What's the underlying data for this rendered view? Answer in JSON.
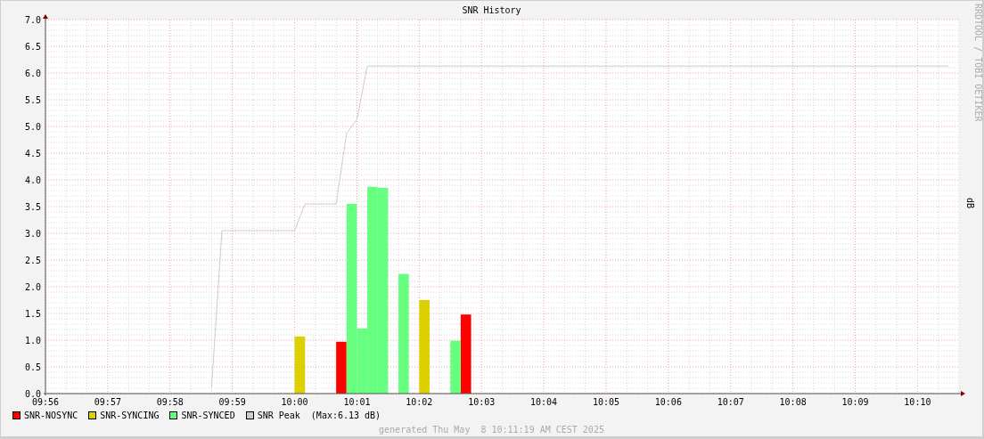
{
  "graph": {
    "title": "SNR History",
    "credit": "RRDTOOL / TOBI OETIKER",
    "legend_note": "(Max:6.13 dB)",
    "footer": "generated Thu May  8 10:11:19 AM CEST 2025",
    "chart_data": {
      "type": "bar",
      "grid": true,
      "ylabel": "dB",
      "ylim": [
        0,
        7
      ],
      "yticks": [
        {
          "value": 0,
          "label": "0.0"
        },
        {
          "value": 0.5,
          "label": "0.5"
        },
        {
          "value": 1,
          "label": "1.0"
        },
        {
          "value": 1.5,
          "label": "1.5"
        },
        {
          "value": 2,
          "label": "2.0"
        },
        {
          "value": 2.5,
          "label": "2.5"
        },
        {
          "value": 3,
          "label": "3.0"
        },
        {
          "value": 3.5,
          "label": "3.5"
        },
        {
          "value": 4,
          "label": "4.0"
        },
        {
          "value": 4.5,
          "label": "4.5"
        },
        {
          "value": 5,
          "label": "5.0"
        },
        {
          "value": 5.5,
          "label": "5.5"
        },
        {
          "value": 6,
          "label": "6.0"
        },
        {
          "value": 6.5,
          "label": "6.5"
        },
        {
          "value": 7,
          "label": "7.0"
        }
      ],
      "categories": [
        "09:56",
        null,
        null,
        null,
        null,
        null,
        "09:57",
        null,
        null,
        null,
        null,
        null,
        "09:58",
        null,
        null,
        null,
        null,
        null,
        "09:59",
        null,
        null,
        null,
        null,
        null,
        "10:00",
        null,
        null,
        null,
        null,
        null,
        "10:01",
        null,
        null,
        null,
        null,
        null,
        "10:02",
        null,
        null,
        null,
        null,
        null,
        "10:03",
        null,
        null,
        null,
        null,
        null,
        "10:04",
        null,
        null,
        null,
        null,
        null,
        "10:05",
        null,
        null,
        null,
        null,
        null,
        "10:06",
        null,
        null,
        null,
        null,
        null,
        "10:07",
        null,
        null,
        null,
        null,
        null,
        "10:08",
        null,
        null,
        null,
        null,
        null,
        "10:09",
        null,
        null,
        null,
        null,
        null,
        "10:10",
        null,
        null,
        null
      ],
      "series": [
        {
          "name": "SNR-NOSYNC",
          "color": "#ff0000",
          "type": "bar",
          "values": [
            null,
            null,
            null,
            null,
            null,
            null,
            null,
            null,
            null,
            null,
            null,
            null,
            null,
            null,
            null,
            null,
            null,
            null,
            null,
            null,
            null,
            null,
            null,
            null,
            null,
            null,
            null,
            null,
            0.97,
            null,
            null,
            null,
            null,
            null,
            null,
            null,
            null,
            null,
            null,
            null,
            1.48,
            null,
            null,
            null,
            null,
            null,
            null,
            null,
            null,
            null,
            null,
            null,
            null,
            null,
            null,
            null,
            null,
            null,
            null,
            null,
            null,
            null,
            null,
            null,
            null,
            null,
            null,
            null,
            null,
            null,
            null,
            null,
            null,
            null,
            null,
            null,
            null,
            null,
            null,
            null,
            null,
            null,
            null,
            null,
            null,
            null,
            null,
            null
          ]
        },
        {
          "name": "SNR-SYNCING",
          "color": "#ddd000",
          "type": "bar",
          "values": [
            null,
            null,
            null,
            null,
            null,
            null,
            null,
            null,
            null,
            null,
            null,
            null,
            null,
            null,
            null,
            null,
            null,
            null,
            null,
            null,
            null,
            null,
            null,
            null,
            1.07,
            null,
            null,
            null,
            null,
            null,
            null,
            null,
            null,
            null,
            null,
            null,
            1.75,
            null,
            null,
            null,
            null,
            null,
            null,
            null,
            null,
            null,
            null,
            null,
            null,
            null,
            null,
            null,
            null,
            null,
            null,
            null,
            null,
            null,
            null,
            null,
            null,
            null,
            null,
            null,
            null,
            null,
            null,
            null,
            null,
            null,
            null,
            null,
            null,
            null,
            null,
            null,
            null,
            null,
            null,
            null,
            null,
            null,
            null,
            null,
            null,
            null,
            null,
            null
          ]
        },
        {
          "name": "SNR-SYNCED",
          "color": "#66ff80",
          "type": "bar",
          "values": [
            null,
            null,
            null,
            null,
            null,
            null,
            null,
            null,
            null,
            null,
            null,
            null,
            null,
            null,
            null,
            null,
            null,
            null,
            null,
            null,
            null,
            null,
            null,
            null,
            null,
            null,
            null,
            null,
            null,
            3.55,
            1.22,
            3.87,
            3.85,
            null,
            2.24,
            null,
            null,
            null,
            null,
            0.99,
            null,
            null,
            null,
            null,
            null,
            null,
            null,
            null,
            null,
            null,
            null,
            null,
            null,
            null,
            null,
            null,
            null,
            null,
            null,
            null,
            null,
            null,
            null,
            null,
            null,
            null,
            null,
            null,
            null,
            null,
            null,
            null,
            null,
            null,
            null,
            null,
            null,
            null,
            null,
            null,
            null,
            null,
            null,
            null,
            null,
            null,
            null,
            null
          ]
        },
        {
          "name": "SNR Peak",
          "color": "#cccccc",
          "type": "line",
          "values": [
            null,
            null,
            null,
            null,
            null,
            null,
            null,
            null,
            null,
            null,
            null,
            null,
            null,
            null,
            null,
            null,
            0.11,
            3.05,
            3.05,
            3.05,
            3.05,
            3.05,
            3.05,
            3.05,
            3.05,
            3.55,
            3.55,
            3.55,
            3.55,
            4.87,
            5.13,
            6.13,
            6.13,
            6.13,
            6.13,
            6.13,
            6.13,
            6.13,
            6.13,
            6.13,
            6.13,
            6.13,
            6.13,
            6.13,
            6.13,
            6.13,
            6.13,
            6.13,
            6.13,
            6.13,
            6.13,
            6.13,
            6.13,
            6.13,
            6.13,
            6.13,
            6.13,
            6.13,
            6.13,
            6.13,
            6.13,
            6.13,
            6.13,
            6.13,
            6.13,
            6.13,
            6.13,
            6.13,
            6.13,
            6.13,
            6.13,
            6.13,
            6.13,
            6.13,
            6.13,
            6.13,
            6.13,
            6.13,
            6.13,
            6.13,
            6.13,
            6.13,
            6.13,
            6.13,
            6.13,
            6.13,
            6.13,
            6.13
          ]
        }
      ]
    }
  }
}
